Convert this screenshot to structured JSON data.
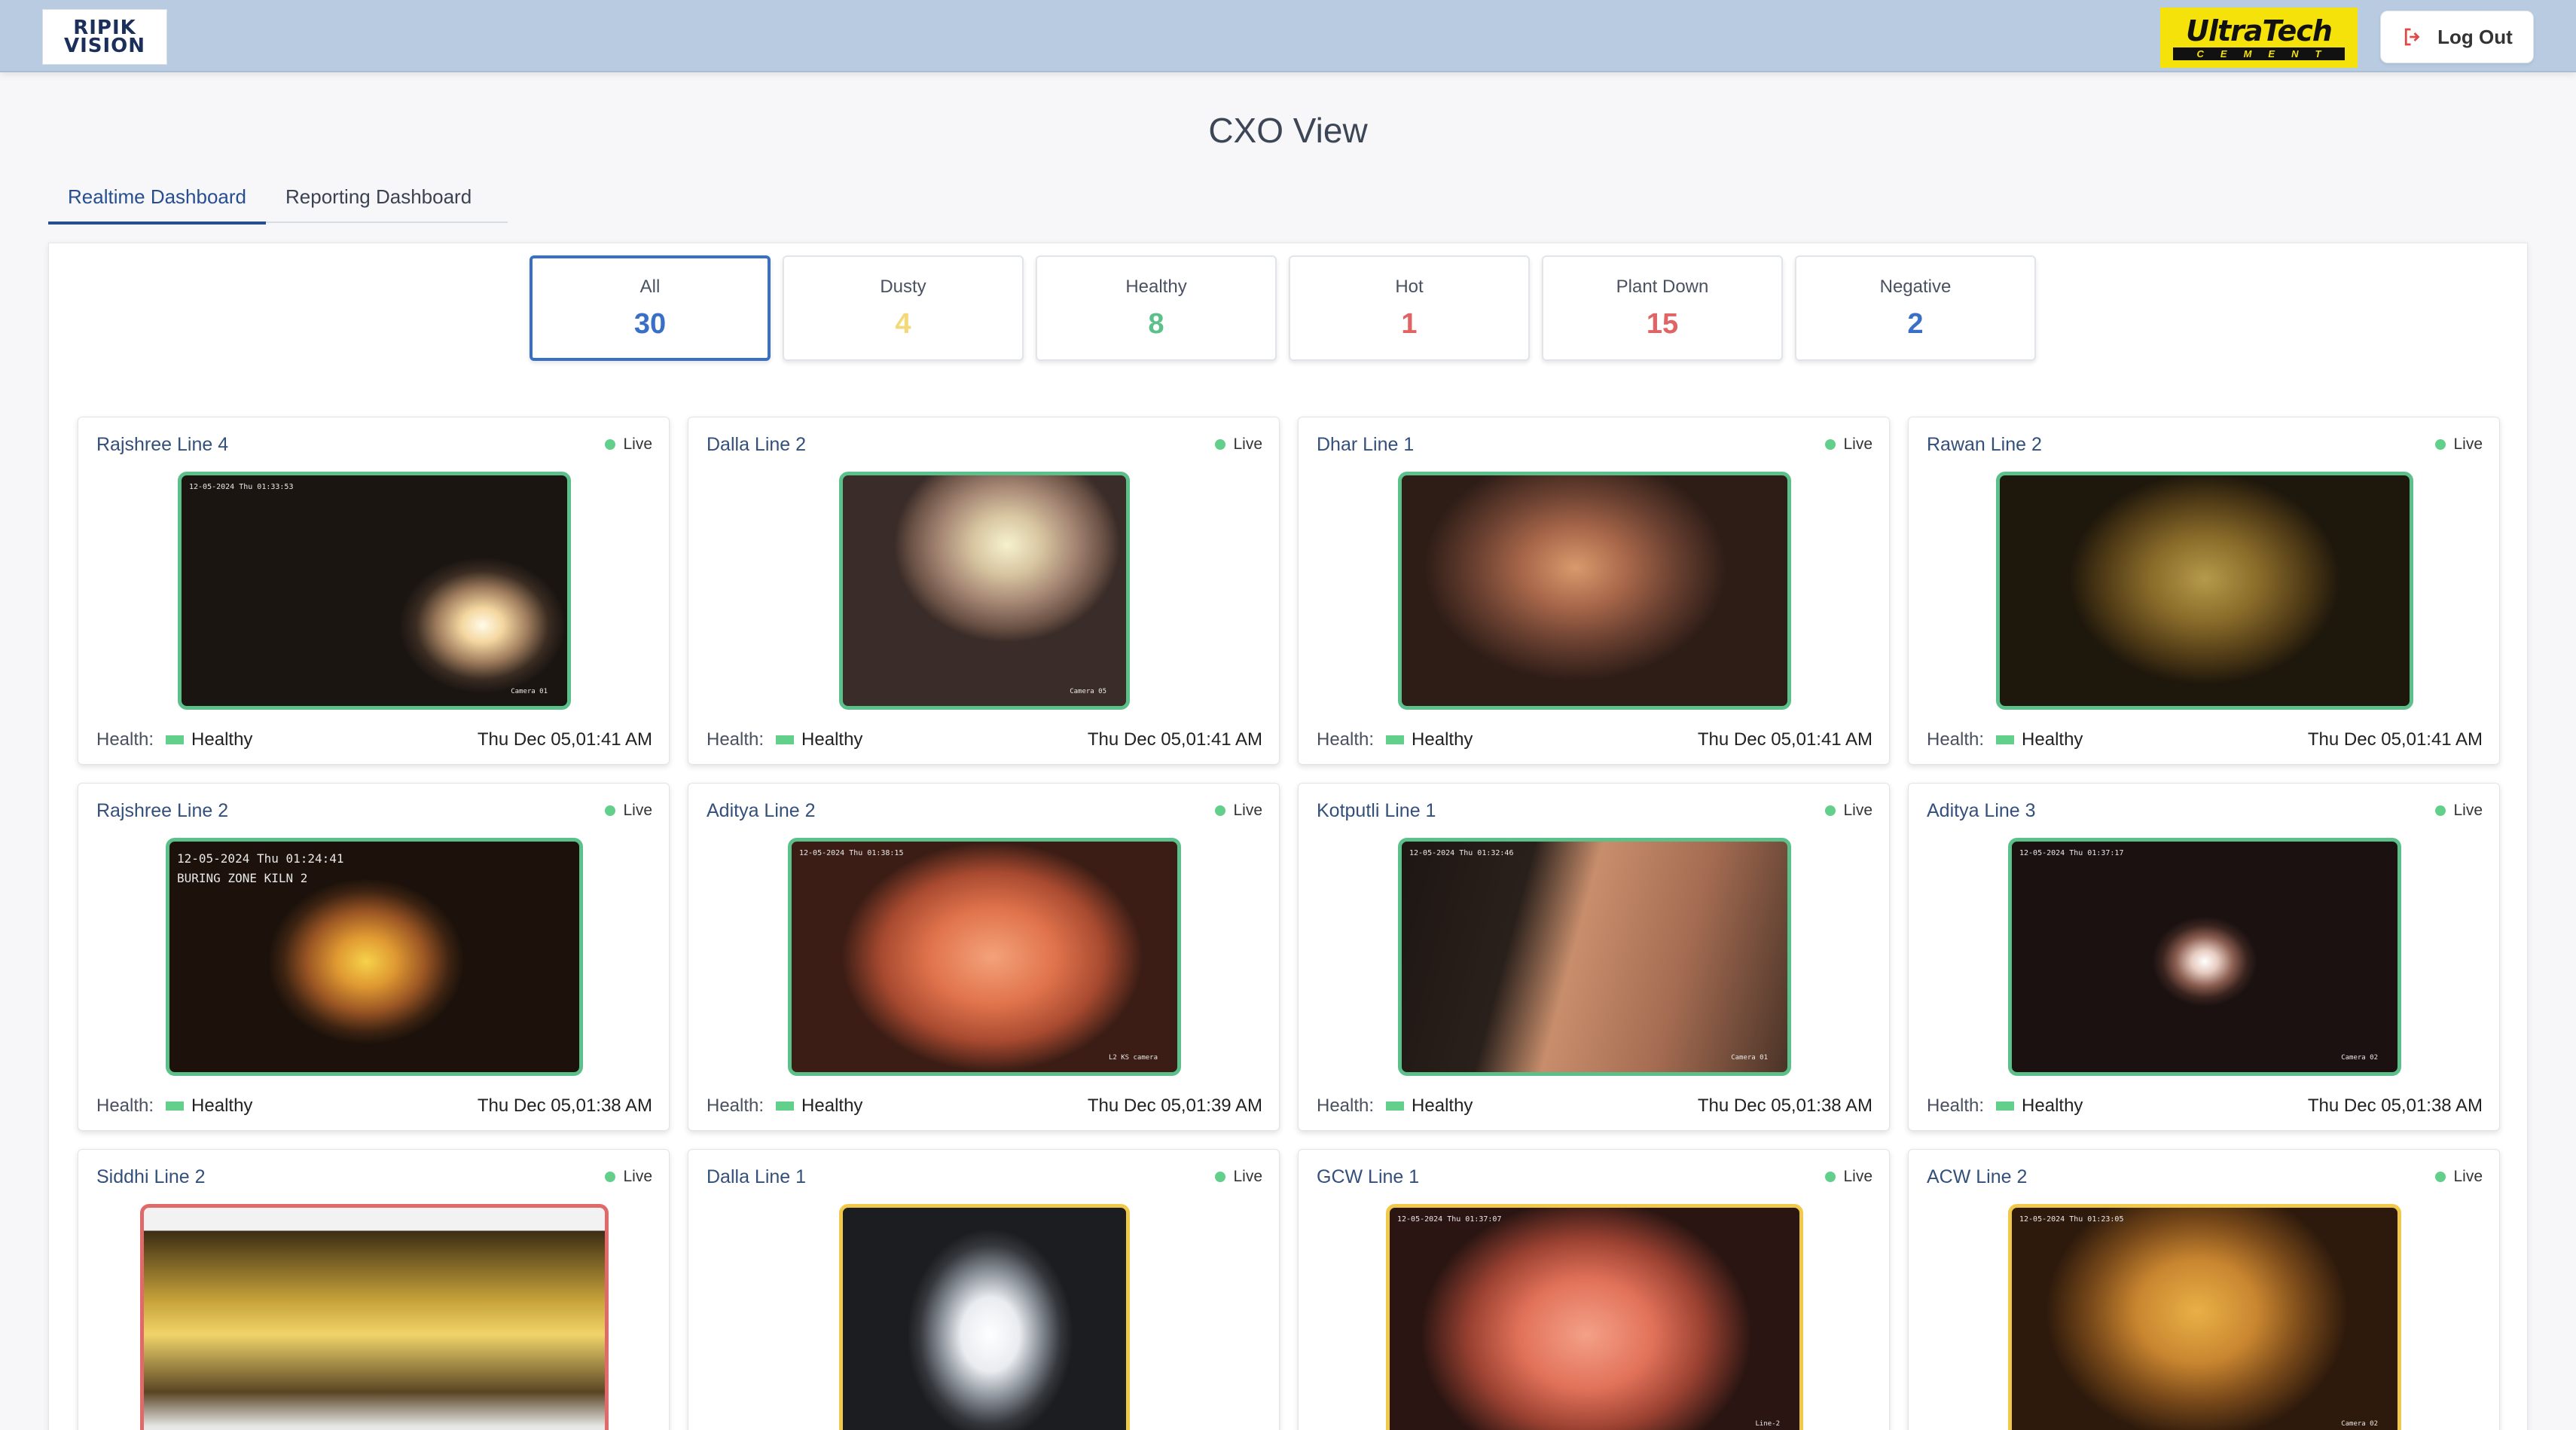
{
  "header": {
    "left_logo_text": "RIPIK VISION",
    "right_logo_brand": "UltraTech",
    "right_logo_sub": "CEMENT",
    "logout_label": "Log Out"
  },
  "page_title": "CXO View",
  "tabs": [
    {
      "label": "Realtime Dashboard",
      "active": true
    },
    {
      "label": "Reporting Dashboard",
      "active": false
    }
  ],
  "filters": [
    {
      "label": "All",
      "count": "30",
      "color": "#3a6fc8",
      "active": true
    },
    {
      "label": "Dusty",
      "count": "4",
      "color": "#f3d97a",
      "active": false
    },
    {
      "label": "Healthy",
      "count": "8",
      "color": "#5cc08a",
      "active": false
    },
    {
      "label": "Hot",
      "count": "1",
      "color": "#e06464",
      "active": false
    },
    {
      "label": "Plant Down",
      "count": "15",
      "color": "#e06464",
      "active": false
    },
    {
      "label": "Negative",
      "count": "2",
      "color": "#3a6fc8",
      "active": false
    }
  ],
  "health_label": "Health:",
  "live_label": "Live",
  "cameras": [
    {
      "name": "Rajshree Line 4",
      "health": "Healthy",
      "timestamp": "Thu Dec 05,01:41 AM",
      "overlay": "12-05-2024 Thu 01:33:53",
      "cam_label": "Camera 01"
    },
    {
      "name": "Dalla Line 2",
      "health": "Healthy",
      "timestamp": "Thu Dec 05,01:41 AM",
      "overlay": "",
      "cam_label": "Camera 05"
    },
    {
      "name": "Dhar Line 1",
      "health": "Healthy",
      "timestamp": "Thu Dec 05,01:41 AM",
      "overlay": "",
      "cam_label": ""
    },
    {
      "name": "Rawan Line 2",
      "health": "Healthy",
      "timestamp": "Thu Dec 05,01:41 AM",
      "overlay": "",
      "cam_label": ""
    },
    {
      "name": "Rajshree Line 2",
      "health": "Healthy",
      "timestamp": "Thu Dec 05,01:38 AM",
      "overlay": "12-05-2024 Thu 01:24:41",
      "overlay2": "BURING ZONE KILN 2",
      "cam_label": ""
    },
    {
      "name": "Aditya Line 2",
      "health": "Healthy",
      "timestamp": "Thu Dec 05,01:39 AM",
      "overlay": "12-05-2024 Thu 01:38:15",
      "cam_label": "L2 KS camera"
    },
    {
      "name": "Kotputli Line 1",
      "health": "Healthy",
      "timestamp": "Thu Dec 05,01:38 AM",
      "overlay": "12-05-2024 Thu 01:32:46",
      "cam_label": "Camera 01"
    },
    {
      "name": "Aditya Line 3",
      "health": "Healthy",
      "timestamp": "Thu Dec 05,01:38 AM",
      "overlay": "12-05-2024 Thu 01:37:17",
      "cam_label": "Camera 02"
    },
    {
      "name": "Siddhi Line 2",
      "health": "",
      "timestamp": "",
      "overlay": "",
      "cam_label": ""
    },
    {
      "name": "Dalla Line 1",
      "health": "",
      "timestamp": "",
      "overlay": "",
      "cam_label": ""
    },
    {
      "name": "GCW Line 1",
      "health": "",
      "timestamp": "",
      "overlay": "12-05-2024 Thu 01:37:07",
      "cam_label": "Line-2"
    },
    {
      "name": "ACW Line 2",
      "health": "",
      "timestamp": "",
      "overlay": "12-05-2024 Thu 01:23:05",
      "cam_label": "Camera 02"
    }
  ]
}
